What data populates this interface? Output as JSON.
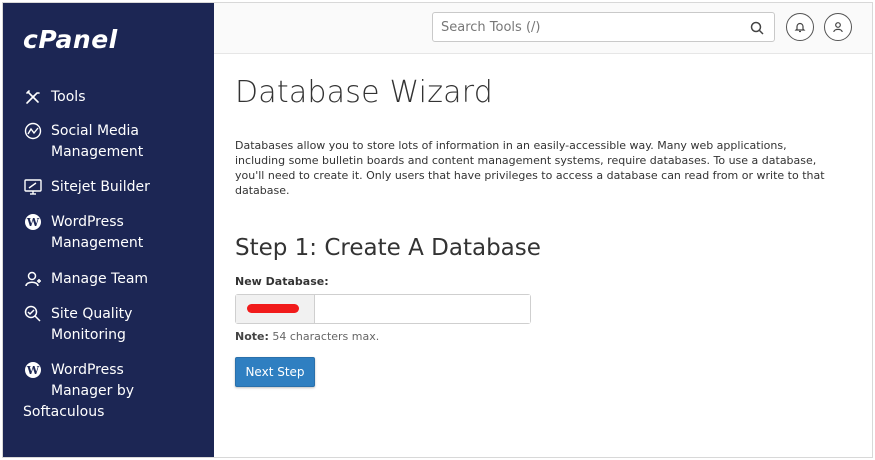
{
  "app": {
    "logo": "cPanel"
  },
  "sidebar": {
    "items": [
      {
        "label": "Tools",
        "icon": "tools-icon"
      },
      {
        "label": "Social Media\nManagement",
        "icon": "social-media-icon"
      },
      {
        "label": "Sitejet Builder",
        "icon": "sitejet-icon"
      },
      {
        "label": "WordPress\nManagement",
        "icon": "wordpress-icon"
      },
      {
        "label": "Manage Team",
        "icon": "manage-team-icon"
      },
      {
        "label": "Site Quality\nMonitoring",
        "icon": "site-quality-icon"
      },
      {
        "label": "WordPress\nManager by",
        "label2": "Softaculous",
        "icon": "wordpress-icon"
      }
    ]
  },
  "header": {
    "search_placeholder": "Search Tools (/)",
    "icons": [
      "search-icon",
      "notification-bell-icon",
      "user-account-icon"
    ]
  },
  "main": {
    "title": "Database Wizard",
    "description": "Databases allow you to store lots of information in an easily-accessible way. Many web applications, including some bulletin boards and content management systems, require databases. To use a database, you'll need to create it. Only users that have privileges to access a database can read from or write to that database.",
    "step_title": "Step 1: Create A Database",
    "field_label": "New Database:",
    "db_name_value": "",
    "note_label": "Note:",
    "note_text": " 54 characters max.",
    "next_button": "Next Step"
  },
  "colors": {
    "sidebar_bg": "#1c2654",
    "primary_button": "#2f7fc1",
    "redaction": "#f11b1b"
  }
}
